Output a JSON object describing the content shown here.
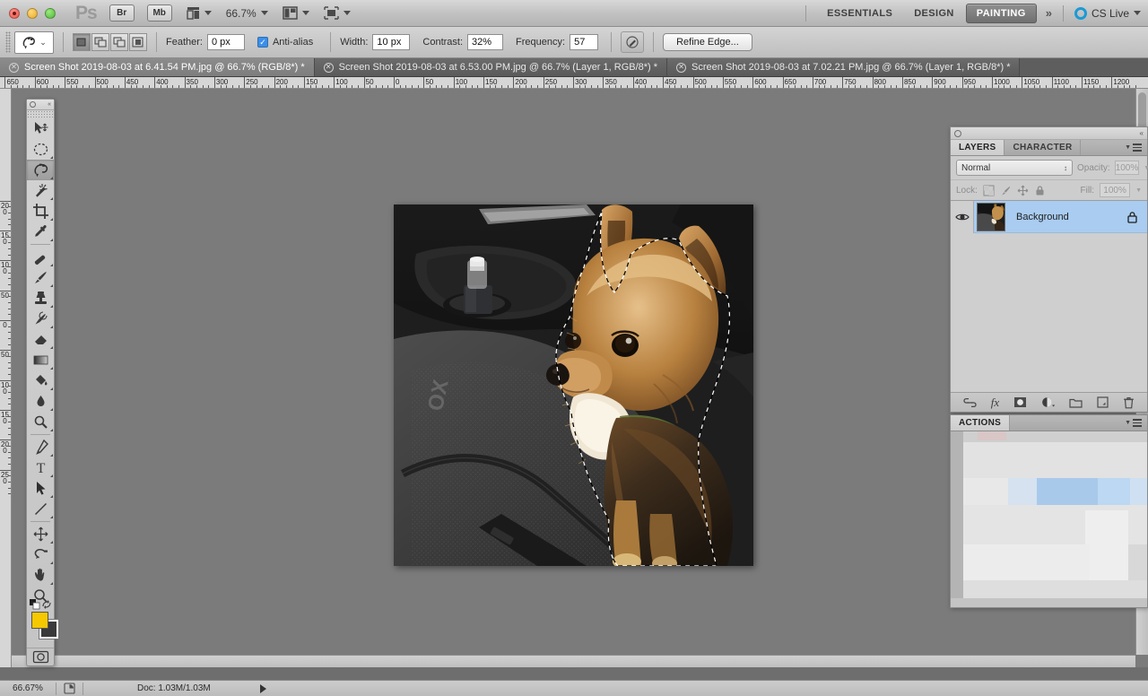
{
  "app": {
    "name": "Adobe Photoshop",
    "logo_text": "Ps"
  },
  "titlebar": {
    "bridge_label": "Br",
    "minibridge_label": "Mb",
    "view_extras_icon": "view-extras-icon",
    "zoom_level": "66.7%",
    "screen_mode_icon": "screen-mode-icon",
    "arrange_docs_icon": "arrange-documents-icon",
    "workspaces": [
      {
        "label": "ESSENTIALS",
        "active": false
      },
      {
        "label": "DESIGN",
        "active": false
      },
      {
        "label": "PAINTING",
        "active": true
      }
    ],
    "more_workspaces": "»",
    "cs_live": "CS Live"
  },
  "options_bar": {
    "tool_icon": "magnetic-lasso-icon",
    "tool_preset_caret": "⌄",
    "selection_modes": [
      {
        "name": "new-selection",
        "active": true
      },
      {
        "name": "add-to-selection",
        "active": false
      },
      {
        "name": "subtract-from-selection",
        "active": false
      },
      {
        "name": "intersect-selection",
        "active": false
      }
    ],
    "feather_label": "Feather:",
    "feather_value": "0 px",
    "antialias_label": "Anti-alias",
    "antialias_checked": true,
    "width_label": "Width:",
    "width_value": "10 px",
    "contrast_label": "Contrast:",
    "contrast_value": "32%",
    "frequency_label": "Frequency:",
    "frequency_value": "57",
    "pen_pressure_icon": "stylus-pressure-icon",
    "refine_edge_label": "Refine Edge..."
  },
  "document_tabs": [
    {
      "title": "Screen Shot 2019-08-03 at 6.41.54 PM.jpg @ 66.7% (RGB/8*) *",
      "active": true
    },
    {
      "title": "Screen Shot 2019-08-03 at 6.53.00 PM.jpg @ 66.7% (Layer 1, RGB/8*) *",
      "active": false
    },
    {
      "title": "Screen Shot 2019-08-03 at 7.02.21 PM.jpg @ 66.7% (Layer 1, RGB/8*) *",
      "active": false
    }
  ],
  "rulers": {
    "unit": "px",
    "horizontal_labels": [
      "650",
      "600",
      "550",
      "500",
      "450",
      "400",
      "350",
      "300",
      "250",
      "200",
      "150",
      "100",
      "50",
      "0",
      "50",
      "100",
      "150",
      "200",
      "250",
      "300",
      "350",
      "400",
      "450",
      "500",
      "550",
      "600",
      "650",
      "700",
      "750",
      "800",
      "850",
      "900",
      "950",
      "1000",
      "1050",
      "1100",
      "1150",
      "1200"
    ],
    "vertical_labels": [
      "200",
      "150",
      "100",
      "50",
      "0",
      "50",
      "100",
      "150",
      "200",
      "250"
    ]
  },
  "toolbar": {
    "tools": [
      {
        "name": "move-tool",
        "icon": "move-icon",
        "selected": false,
        "has_flyout": false
      },
      {
        "name": "elliptical-marquee-tool",
        "icon": "marquee-ellipse-icon",
        "selected": false,
        "has_flyout": true
      },
      {
        "name": "magnetic-lasso-tool",
        "icon": "lasso-icon",
        "selected": true,
        "has_flyout": true
      },
      {
        "name": "magic-wand-tool",
        "icon": "magic-wand-icon",
        "selected": false,
        "has_flyout": true
      },
      {
        "name": "crop-tool",
        "icon": "crop-icon",
        "selected": false,
        "has_flyout": true
      },
      {
        "name": "eyedropper-tool",
        "icon": "eyedropper-icon",
        "selected": false,
        "has_flyout": true
      },
      {
        "name": "spot-healing-brush-tool",
        "icon": "healing-brush-icon",
        "selected": false,
        "has_flyout": true
      },
      {
        "name": "brush-tool",
        "icon": "brush-icon",
        "selected": false,
        "has_flyout": true
      },
      {
        "name": "clone-stamp-tool",
        "icon": "clone-stamp-icon",
        "selected": false,
        "has_flyout": true
      },
      {
        "name": "history-brush-tool",
        "icon": "history-brush-icon",
        "selected": false,
        "has_flyout": true
      },
      {
        "name": "eraser-tool",
        "icon": "eraser-icon",
        "selected": false,
        "has_flyout": true
      },
      {
        "name": "gradient-tool",
        "icon": "gradient-icon",
        "selected": false,
        "has_flyout": true
      },
      {
        "name": "paint-bucket-tool",
        "icon": "paint-bucket-icon",
        "selected": false,
        "has_flyout": true
      },
      {
        "name": "blur-tool",
        "icon": "blur-droplet-icon",
        "selected": false,
        "has_flyout": true
      },
      {
        "name": "dodge-tool",
        "icon": "dodge-icon",
        "selected": false,
        "has_flyout": true
      },
      {
        "name": "pen-tool",
        "icon": "pen-icon",
        "selected": false,
        "has_flyout": true
      },
      {
        "name": "type-tool",
        "icon": "type-T-icon",
        "selected": false,
        "has_flyout": true
      },
      {
        "name": "path-selection-tool",
        "icon": "path-arrow-icon",
        "selected": false,
        "has_flyout": true
      },
      {
        "name": "line-tool",
        "icon": "line-icon",
        "selected": false,
        "has_flyout": true
      },
      {
        "name": "3d-rotate-tool",
        "icon": "3d-rotate-icon",
        "selected": false,
        "has_flyout": true
      },
      {
        "name": "3d-orbit-tool",
        "icon": "3d-orbit-icon",
        "selected": false,
        "has_flyout": true
      },
      {
        "name": "hand-tool",
        "icon": "hand-icon",
        "selected": false,
        "has_flyout": true
      },
      {
        "name": "zoom-tool",
        "icon": "magnifier-icon",
        "selected": false,
        "has_flyout": false
      }
    ],
    "foreground_color": "#f5c800",
    "background_color": "#3a3a3a",
    "quick_mask_icon": "quick-mask-icon"
  },
  "layers_panel": {
    "tabs": [
      {
        "label": "LAYERS",
        "active": true
      },
      {
        "label": "CHARACTER",
        "active": false
      }
    ],
    "blend_mode": "Normal",
    "opacity_label": "Opacity:",
    "opacity_value": "100%",
    "lock_label": "Lock:",
    "lock_icons": [
      "lock-transparent-pixels-icon",
      "lock-image-pixels-icon",
      "lock-position-icon",
      "lock-all-icon"
    ],
    "fill_label": "Fill:",
    "fill_value": "100%",
    "layers": [
      {
        "name": "Background",
        "locked": true,
        "visible": true,
        "selected": true
      }
    ],
    "footer_icons": [
      "link-layers-icon",
      "layer-style-fx-icon",
      "add-layer-mask-icon",
      "new-adjustment-layer-icon",
      "new-group-icon",
      "new-layer-icon",
      "delete-layer-icon"
    ]
  },
  "actions_panel": {
    "tabs": [
      {
        "label": "ACTIONS",
        "active": true
      }
    ]
  },
  "canvas": {
    "image_description": "Photo of a small tan and black terrier dog sitting on a car seat, with an active marching-ants selection outline around the dog",
    "selection_active": true
  },
  "status_bar": {
    "zoom": "66.67%",
    "doc_info": "Doc: 1.03M/1.03M",
    "preview_icon": "document-preview-icon",
    "expand_icon": "expand-arrow-icon"
  }
}
